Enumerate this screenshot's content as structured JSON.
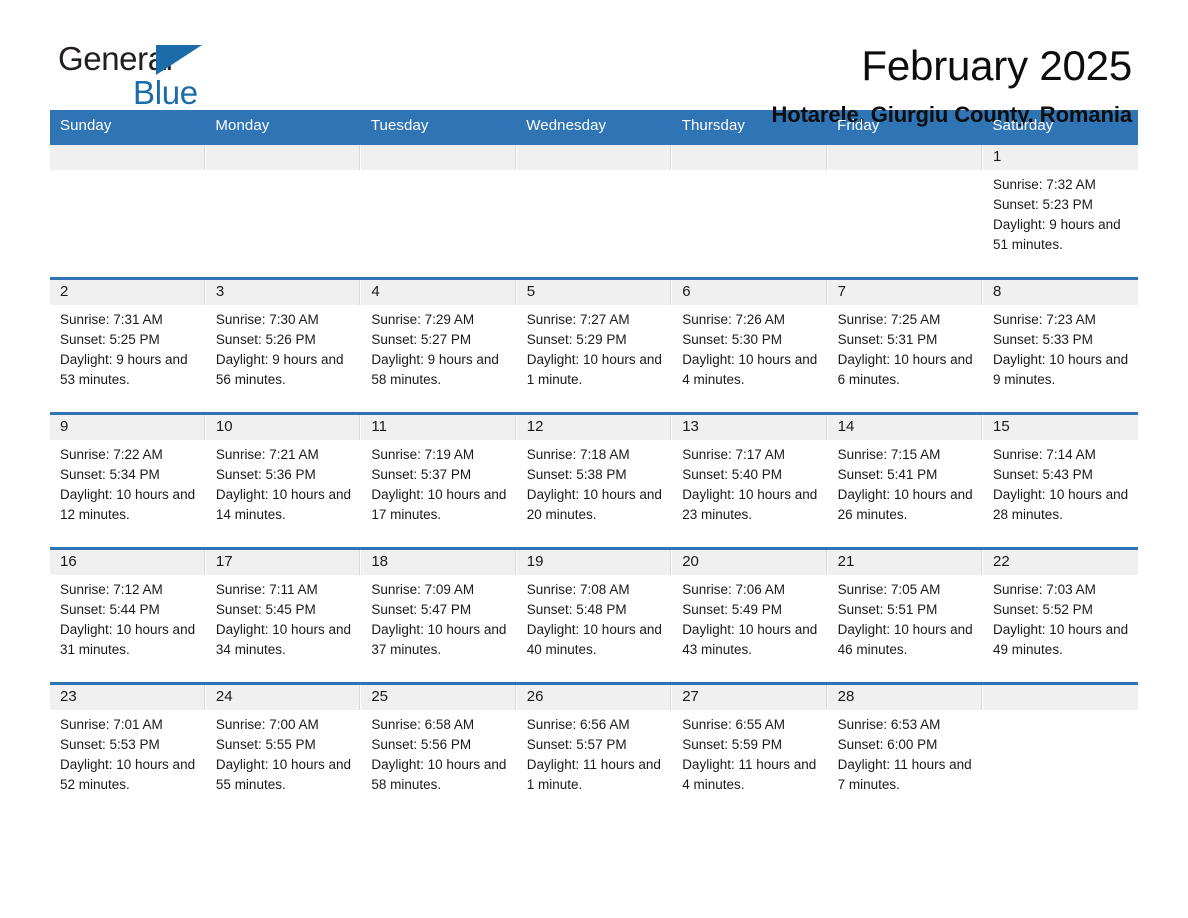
{
  "brand": {
    "word1": "General",
    "word2": "Blue",
    "triangle_color": "#1b6ca8"
  },
  "header": {
    "title": "February 2025",
    "subtitle": "Hotarele, Giurgiu County, Romania"
  },
  "colors": {
    "header_blue": "#2f74b5",
    "cell_header_gray": "#f0f0f0",
    "text": "#1a1a1a"
  },
  "day_headers": [
    "Sunday",
    "Monday",
    "Tuesday",
    "Wednesday",
    "Thursday",
    "Friday",
    "Saturday"
  ],
  "weeks": [
    [
      {
        "day": "",
        "empty": true
      },
      {
        "day": "",
        "empty": true
      },
      {
        "day": "",
        "empty": true
      },
      {
        "day": "",
        "empty": true
      },
      {
        "day": "",
        "empty": true
      },
      {
        "day": "",
        "empty": true
      },
      {
        "day": "1",
        "sunrise": "Sunrise: 7:32 AM",
        "sunset": "Sunset: 5:23 PM",
        "daylight": "Daylight: 9 hours and 51 minutes."
      }
    ],
    [
      {
        "day": "2",
        "sunrise": "Sunrise: 7:31 AM",
        "sunset": "Sunset: 5:25 PM",
        "daylight": "Daylight: 9 hours and 53 minutes."
      },
      {
        "day": "3",
        "sunrise": "Sunrise: 7:30 AM",
        "sunset": "Sunset: 5:26 PM",
        "daylight": "Daylight: 9 hours and 56 minutes."
      },
      {
        "day": "4",
        "sunrise": "Sunrise: 7:29 AM",
        "sunset": "Sunset: 5:27 PM",
        "daylight": "Daylight: 9 hours and 58 minutes."
      },
      {
        "day": "5",
        "sunrise": "Sunrise: 7:27 AM",
        "sunset": "Sunset: 5:29 PM",
        "daylight": "Daylight: 10 hours and 1 minute."
      },
      {
        "day": "6",
        "sunrise": "Sunrise: 7:26 AM",
        "sunset": "Sunset: 5:30 PM",
        "daylight": "Daylight: 10 hours and 4 minutes."
      },
      {
        "day": "7",
        "sunrise": "Sunrise: 7:25 AM",
        "sunset": "Sunset: 5:31 PM",
        "daylight": "Daylight: 10 hours and 6 minutes."
      },
      {
        "day": "8",
        "sunrise": "Sunrise: 7:23 AM",
        "sunset": "Sunset: 5:33 PM",
        "daylight": "Daylight: 10 hours and 9 minutes."
      }
    ],
    [
      {
        "day": "9",
        "sunrise": "Sunrise: 7:22 AM",
        "sunset": "Sunset: 5:34 PM",
        "daylight": "Daylight: 10 hours and 12 minutes."
      },
      {
        "day": "10",
        "sunrise": "Sunrise: 7:21 AM",
        "sunset": "Sunset: 5:36 PM",
        "daylight": "Daylight: 10 hours and 14 minutes."
      },
      {
        "day": "11",
        "sunrise": "Sunrise: 7:19 AM",
        "sunset": "Sunset: 5:37 PM",
        "daylight": "Daylight: 10 hours and 17 minutes."
      },
      {
        "day": "12",
        "sunrise": "Sunrise: 7:18 AM",
        "sunset": "Sunset: 5:38 PM",
        "daylight": "Daylight: 10 hours and 20 minutes."
      },
      {
        "day": "13",
        "sunrise": "Sunrise: 7:17 AM",
        "sunset": "Sunset: 5:40 PM",
        "daylight": "Daylight: 10 hours and 23 minutes."
      },
      {
        "day": "14",
        "sunrise": "Sunrise: 7:15 AM",
        "sunset": "Sunset: 5:41 PM",
        "daylight": "Daylight: 10 hours and 26 minutes."
      },
      {
        "day": "15",
        "sunrise": "Sunrise: 7:14 AM",
        "sunset": "Sunset: 5:43 PM",
        "daylight": "Daylight: 10 hours and 28 minutes."
      }
    ],
    [
      {
        "day": "16",
        "sunrise": "Sunrise: 7:12 AM",
        "sunset": "Sunset: 5:44 PM",
        "daylight": "Daylight: 10 hours and 31 minutes."
      },
      {
        "day": "17",
        "sunrise": "Sunrise: 7:11 AM",
        "sunset": "Sunset: 5:45 PM",
        "daylight": "Daylight: 10 hours and 34 minutes."
      },
      {
        "day": "18",
        "sunrise": "Sunrise: 7:09 AM",
        "sunset": "Sunset: 5:47 PM",
        "daylight": "Daylight: 10 hours and 37 minutes."
      },
      {
        "day": "19",
        "sunrise": "Sunrise: 7:08 AM",
        "sunset": "Sunset: 5:48 PM",
        "daylight": "Daylight: 10 hours and 40 minutes."
      },
      {
        "day": "20",
        "sunrise": "Sunrise: 7:06 AM",
        "sunset": "Sunset: 5:49 PM",
        "daylight": "Daylight: 10 hours and 43 minutes."
      },
      {
        "day": "21",
        "sunrise": "Sunrise: 7:05 AM",
        "sunset": "Sunset: 5:51 PM",
        "daylight": "Daylight: 10 hours and 46 minutes."
      },
      {
        "day": "22",
        "sunrise": "Sunrise: 7:03 AM",
        "sunset": "Sunset: 5:52 PM",
        "daylight": "Daylight: 10 hours and 49 minutes."
      }
    ],
    [
      {
        "day": "23",
        "sunrise": "Sunrise: 7:01 AM",
        "sunset": "Sunset: 5:53 PM",
        "daylight": "Daylight: 10 hours and 52 minutes."
      },
      {
        "day": "24",
        "sunrise": "Sunrise: 7:00 AM",
        "sunset": "Sunset: 5:55 PM",
        "daylight": "Daylight: 10 hours and 55 minutes."
      },
      {
        "day": "25",
        "sunrise": "Sunrise: 6:58 AM",
        "sunset": "Sunset: 5:56 PM",
        "daylight": "Daylight: 10 hours and 58 minutes."
      },
      {
        "day": "26",
        "sunrise": "Sunrise: 6:56 AM",
        "sunset": "Sunset: 5:57 PM",
        "daylight": "Daylight: 11 hours and 1 minute."
      },
      {
        "day": "27",
        "sunrise": "Sunrise: 6:55 AM",
        "sunset": "Sunset: 5:59 PM",
        "daylight": "Daylight: 11 hours and 4 minutes."
      },
      {
        "day": "28",
        "sunrise": "Sunrise: 6:53 AM",
        "sunset": "Sunset: 6:00 PM",
        "daylight": "Daylight: 11 hours and 7 minutes."
      },
      {
        "day": "",
        "empty": true
      }
    ]
  ]
}
